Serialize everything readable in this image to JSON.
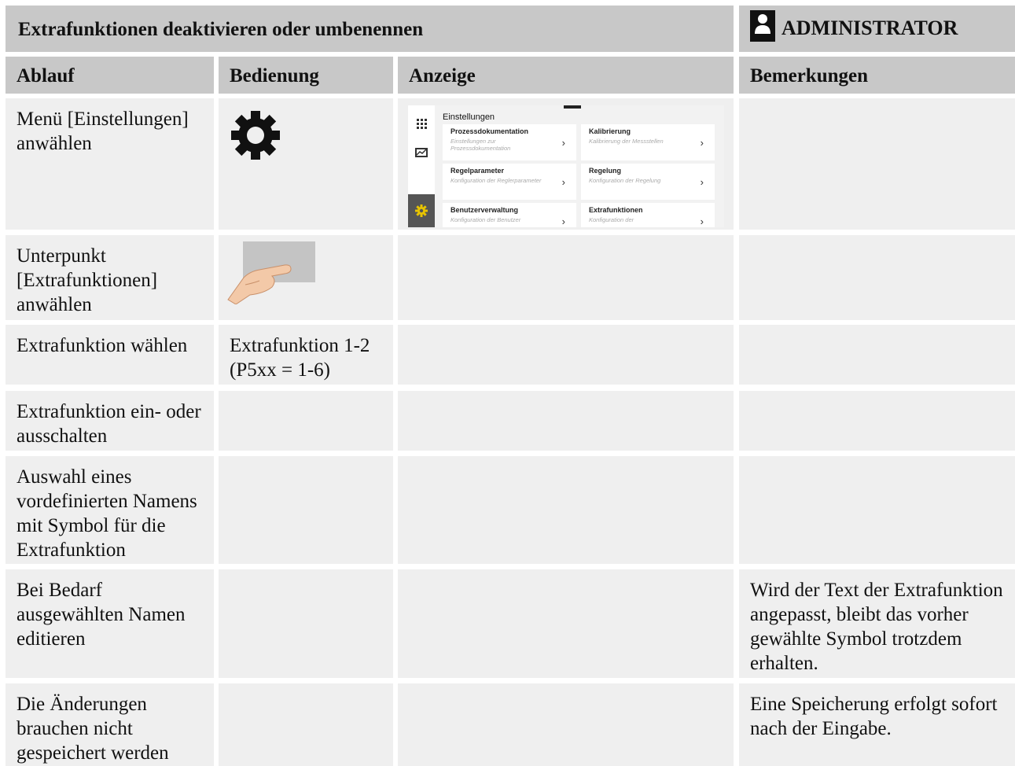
{
  "header": {
    "title": "Extrafunktionen deaktivieren oder umbenennen",
    "role": "ADMINISTRATOR"
  },
  "columns": [
    "Ablauf",
    "Bedienung",
    "Anzeige",
    "Bemerkungen"
  ],
  "rows": [
    {
      "ablauf": "Menü [Einstellungen] anwählen",
      "bedienung": "",
      "bemerkungen": ""
    },
    {
      "ablauf": "Unterpunkt [Extrafunktionen] anwählen",
      "bedienung": "",
      "bemerkungen": ""
    },
    {
      "ablauf": "Extrafunktion wählen",
      "bedienung": "Extrafunktion 1-2 (P5xx = 1-6)",
      "bemerkungen": ""
    },
    {
      "ablauf": "Extrafunktion ein- oder ausschalten",
      "bedienung": "",
      "bemerkungen": ""
    },
    {
      "ablauf": "Auswahl eines vordefinierten Namens mit Symbol für die Extrafunktion",
      "bedienung": "",
      "bemerkungen": ""
    },
    {
      "ablauf": "Bei Bedarf ausgewählten Namen editieren",
      "bedienung": "",
      "bemerkungen": "Wird der Text der Extrafunktion angepasst, bleibt das vorher gewählte Symbol trotzdem erhalten."
    },
    {
      "ablauf": "Die Änderungen brauchen nicht gespeichert werden",
      "bedienung": "",
      "bemerkungen": "Eine Speicherung erfolgt sofort nach der Eingabe."
    }
  ],
  "screenshot": {
    "title": "Einstellungen",
    "tiles": [
      {
        "heading": "Prozessdokumentation",
        "sub": "Einstellungen zur Prozessdokumentation"
      },
      {
        "heading": "Kalibrierung",
        "sub": "Kalibrierung der Messstellen"
      },
      {
        "heading": "Regelparameter",
        "sub": "Konfiguration der Reglerparameter"
      },
      {
        "heading": "Regelung",
        "sub": "Konfiguration der Regelung"
      },
      {
        "heading": "Benutzerverwaltung",
        "sub": "Konfiguration der Benutzer"
      },
      {
        "heading": "Extrafunktionen",
        "sub": "Konfiguration der"
      }
    ],
    "chevron": "›",
    "accent": "#e8c400"
  },
  "colors": {
    "header_bg": "#c8c8c8",
    "cell_bg": "#efefef"
  },
  "icons": [
    "user-icon",
    "gear-icon",
    "touch-hand-icon",
    "grid-icon",
    "chart-icon",
    "settings-gear-icon"
  ]
}
